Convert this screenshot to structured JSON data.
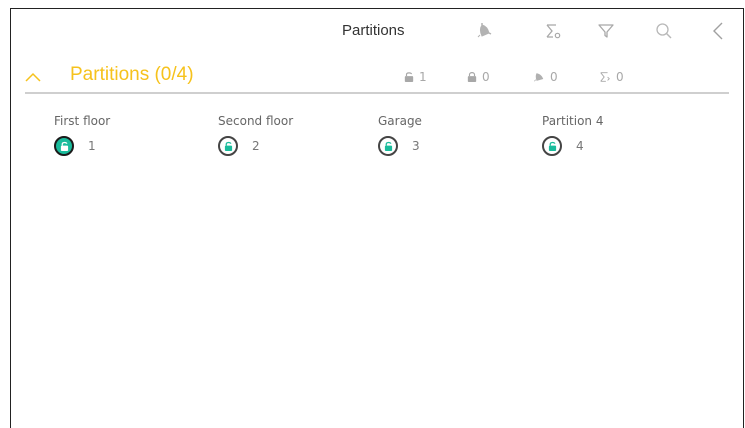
{
  "header": {
    "title": "Partitions"
  },
  "section": {
    "title": "Partitions (0/4)",
    "accent_color": "#f6c21c",
    "stats": {
      "unlocked": "1",
      "locked": "0",
      "alarm": "0",
      "bypass": "0"
    }
  },
  "partitions": [
    {
      "name": "First floor",
      "number": "1",
      "state": "unlocked-selected"
    },
    {
      "name": "Second floor",
      "number": "2",
      "state": "unlocked"
    },
    {
      "name": "Garage",
      "number": "3",
      "state": "unlocked"
    },
    {
      "name": "Partition 4",
      "number": "4",
      "state": "unlocked"
    }
  ],
  "colors": {
    "status_green": "#1abc9c",
    "icon_gray": "#a8a8a8"
  }
}
